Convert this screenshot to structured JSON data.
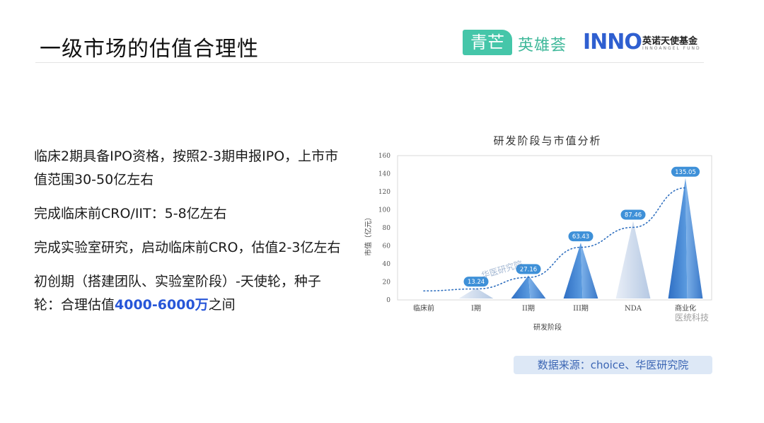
{
  "page": {
    "title": "一级市场的估值合理性"
  },
  "logos": {
    "qingmang": "青芒",
    "yingxionghui": "英雄荟",
    "inno": "INNO",
    "inno_cn": "英诺天使基金",
    "inno_en": "INNOANGEL FUND"
  },
  "bullets": [
    {
      "text": "临床2期具备IPO资格，按照2-3期申报IPO，上市市值范围30-50亿左右"
    },
    {
      "text": "完成临床前CRO/IIT：5-8亿左右"
    },
    {
      "text": "完成实验室研究，启动临床前CRO，估值2-3亿左右"
    },
    {
      "prefix": "初创期（搭建团队、实验室阶段）-天使轮，种子轮：合理估值",
      "highlight": "4000-6000万",
      "suffix": "之间"
    }
  ],
  "source": "数据来源：choice、华医研究院",
  "colors": {
    "highlight": "#2756d8",
    "bar_main": "#3d80d0",
    "bar_light": "#c4d6ec",
    "label_bg": "#3e90d8",
    "trend": "#2f6fbf"
  },
  "chart_data": {
    "type": "bar",
    "title": "研发阶段与市值分析",
    "xlabel": "研发阶段",
    "ylabel": "市值（亿元）",
    "ylim": [
      0,
      160
    ],
    "yticks": [
      0,
      20,
      40,
      60,
      80,
      100,
      120,
      140,
      160
    ],
    "categories": [
      "临床前",
      "I期",
      "II期",
      "III期",
      "NDA",
      "商业化"
    ],
    "values": [
      null,
      13.24,
      27.16,
      63.43,
      87.46,
      135.05
    ],
    "data_labels": [
      "",
      "13.24",
      "27.16",
      "63.43",
      "87.46",
      "135.05"
    ],
    "bar_shape": "cone",
    "trend_line": "dotted",
    "grid": false,
    "watermarks": [
      "华医研究院",
      "医统科技"
    ]
  }
}
